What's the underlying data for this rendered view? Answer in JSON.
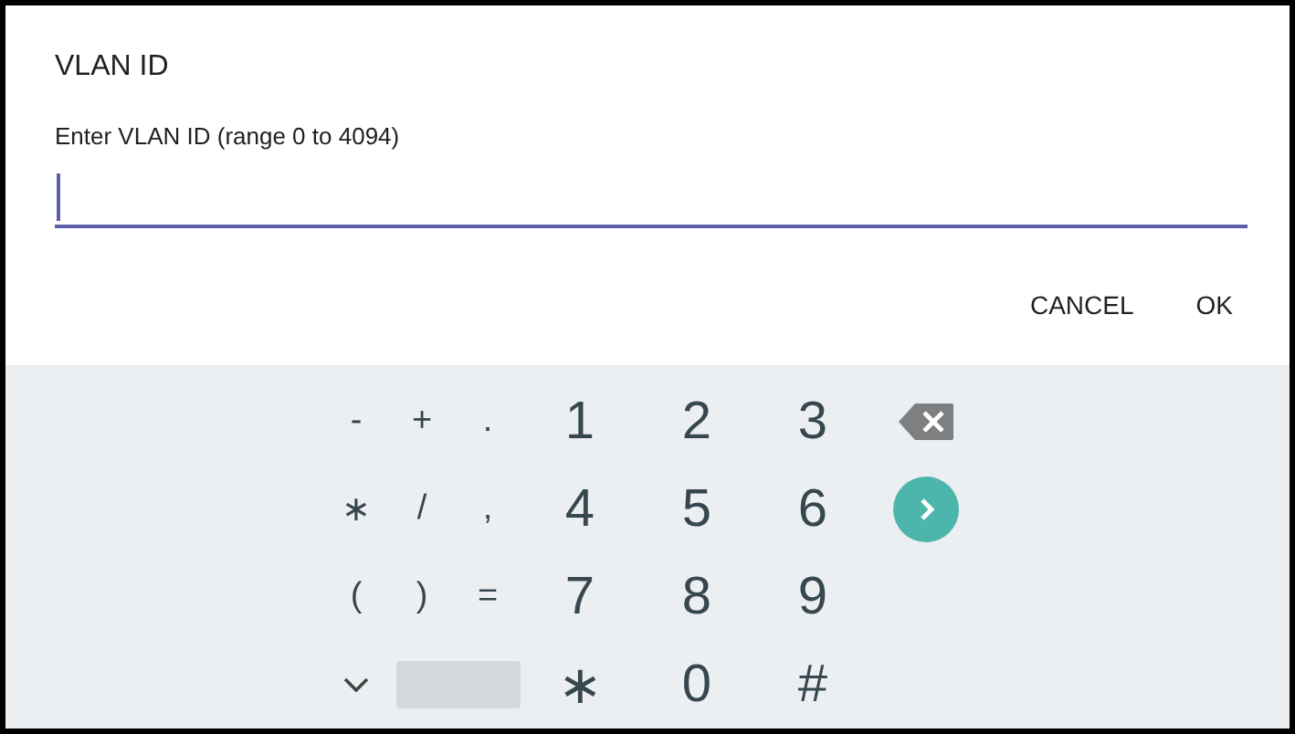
{
  "dialog": {
    "title": "VLAN ID",
    "label": "Enter VLAN ID (range 0 to 4094)",
    "field": {
      "focused": true
    },
    "buttons": [
      "CANCEL",
      "OK"
    ]
  },
  "keyboard": {
    "rows": [
      [
        {
          "kind": "symbol",
          "label": "-"
        },
        {
          "kind": "symbol",
          "label": "+"
        },
        {
          "kind": "symbol",
          "label": "."
        },
        {
          "kind": "digit",
          "label": "1"
        },
        {
          "kind": "digit",
          "label": "2"
        },
        {
          "kind": "digit",
          "label": "3"
        },
        {
          "kind": "backspace"
        }
      ],
      [
        {
          "kind": "symbol",
          "label": "∗"
        },
        {
          "kind": "symbol",
          "label": "/"
        },
        {
          "kind": "symbol",
          "label": ","
        },
        {
          "kind": "digit",
          "label": "4"
        },
        {
          "kind": "digit",
          "label": "5"
        },
        {
          "kind": "digit",
          "label": "6"
        },
        {
          "kind": "enter"
        }
      ],
      [
        {
          "kind": "symbol",
          "label": "("
        },
        {
          "kind": "symbol",
          "label": ")"
        },
        {
          "kind": "symbol",
          "label": "="
        },
        {
          "kind": "digit",
          "label": "7"
        },
        {
          "kind": "digit",
          "label": "8"
        },
        {
          "kind": "digit",
          "label": "9"
        }
      ],
      [
        {
          "kind": "hide"
        },
        {
          "kind": "space"
        },
        "",
        {
          "kind": "digit",
          "label": "∗"
        },
        {
          "kind": "digit",
          "label": "0"
        },
        {
          "kind": "digit",
          "label": "#"
        }
      ]
    ]
  }
}
